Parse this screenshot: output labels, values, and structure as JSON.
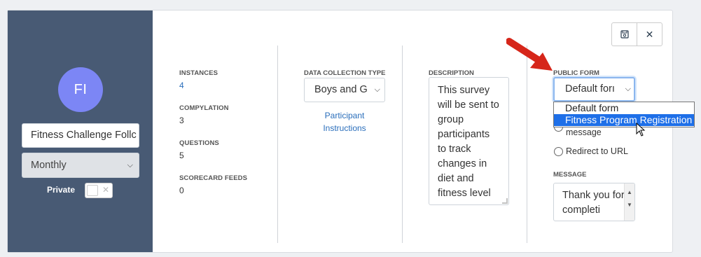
{
  "sidebar": {
    "avatar_initials": "FI",
    "survey_name": "Fitness Challenge Follc",
    "frequency": "Monthly",
    "private_label": "Private",
    "private_toggle_state": "off"
  },
  "stats": {
    "instances_label": "INSTANCES",
    "instances_value": "4",
    "compylation_label": "COMPYLATION",
    "compylation_value": "3",
    "questions_label": "QUESTIONS",
    "questions_value": "5",
    "scorecard_label": "SCORECARD FEEDS",
    "scorecard_value": "0"
  },
  "data_collection": {
    "label": "DATA COLLECTION TYPE",
    "selected": "Boys and G",
    "link_line1": "Participant",
    "link_line2": "Instructions"
  },
  "description": {
    "label": "DESCRIPTION",
    "text": "This survey will be sent to group participants to track changes in diet and fitness level"
  },
  "public_form": {
    "label": "PUBLIC FORM",
    "selected": "Default forı",
    "options": [
      "Default form",
      "Fitness Program Registration"
    ],
    "highlighted_option_index": 1,
    "radio_message_text": "message",
    "radio_redirect_text": "Redirect to URL",
    "message_label": "MESSAGE",
    "message_text": "Thank you for completi"
  },
  "toolbar": {
    "save_icon": "save-icon",
    "close_icon": "close-icon"
  },
  "colors": {
    "sidebar_bg": "#485a74",
    "avatar_bg": "#7c86f5",
    "link": "#2a6ebb",
    "option_highlight": "#1e6fe8",
    "annotation_arrow": "#d6261a"
  }
}
